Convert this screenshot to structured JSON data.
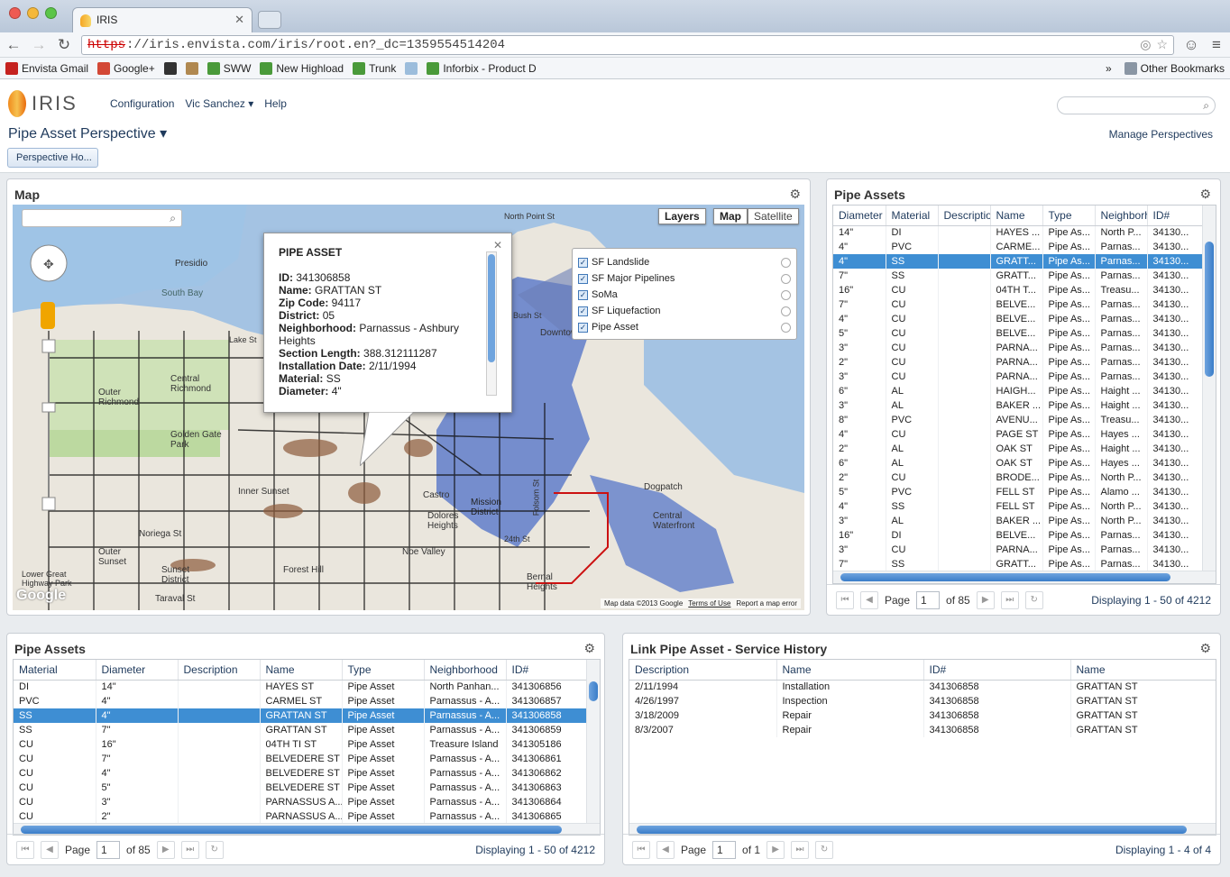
{
  "browser": {
    "tab_title": "IRIS",
    "url_scheme": "https",
    "url_rest": "://iris.envista.com/iris/root.en?_dc=1359554514204",
    "bookmarks": [
      {
        "label": "Envista Gmail",
        "color": "#c5221f"
      },
      {
        "label": "Google+",
        "color": "#d34836"
      },
      {
        "label": "",
        "color": "#333333"
      },
      {
        "label": "",
        "color": "#b08850"
      },
      {
        "label": "SWW",
        "color": "#4a9a3a"
      },
      {
        "label": "New Highload",
        "color": "#4a9a3a"
      },
      {
        "label": "Trunk",
        "color": "#4a9a3a"
      },
      {
        "label": "",
        "color": "#9cbddc"
      },
      {
        "label": "Inforbix - Product D",
        "color": "#4a9a3a"
      }
    ],
    "bookmark_more": "»",
    "other_bookmarks": "Other Bookmarks"
  },
  "header": {
    "logo_text": "IRIS",
    "nav": [
      "Configuration",
      "Vic Sanchez ▾",
      "Help"
    ],
    "search_placeholder": "",
    "perspective_title": "Pipe Asset Perspective ▾",
    "manage_perspectives": "Manage Perspectives",
    "perspective_home_button": "Perspective Ho..."
  },
  "map_panel": {
    "title": "Map",
    "layers_button": "Layers",
    "map_button": "Map",
    "satellite_button": "Satellite",
    "layers": [
      "SF Landslide",
      "SF Major Pipelines",
      "SoMa",
      "SF Liquefaction",
      "Pipe Asset"
    ],
    "attribution": "Map data ©2013 Google",
    "terms": "Terms of Use",
    "report": "Report a map error",
    "google_logo": "Google",
    "popup": {
      "heading": "PIPE ASSET",
      "fields": [
        {
          "label": "ID:",
          "value": "341306858"
        },
        {
          "label": "Name:",
          "value": "GRATTAN ST"
        },
        {
          "label": "Zip Code:",
          "value": "94117"
        },
        {
          "label": "District:",
          "value": "05"
        },
        {
          "label": "Neighborhood:",
          "value": "Parnassus - Ashbury Heights"
        },
        {
          "label": "Section Length:",
          "value": "388.312111287"
        },
        {
          "label": "Installation Date:",
          "value": "2/11/1994"
        },
        {
          "label": "Material:",
          "value": "SS"
        },
        {
          "label": "Diameter:",
          "value": "4\""
        }
      ]
    },
    "place_labels": [
      "South Bay",
      "Outer Richmond",
      "Central Richmond",
      "Golden Gate Park",
      "Inner Sunset",
      "Outer Sunset",
      "Sunset District",
      "Noriega St",
      "Taraval St",
      "Castro",
      "Dolores Heights",
      "Mission District",
      "Noe Valley",
      "Forest Hill",
      "Bernal Heights",
      "Central Waterfront",
      "Dogpatch",
      "Downtown",
      "Bush St",
      "North Point St",
      "Lake St",
      "Presidio",
      "Lower Great Highway Park",
      "24th St",
      "Folsom St"
    ]
  },
  "pipe_assets_right": {
    "title": "Pipe Assets",
    "columns": [
      "Diameter",
      "Material",
      "Description",
      "Name",
      "Type",
      "Neighborhood",
      "ID#"
    ],
    "rows": [
      [
        "14\"",
        "DI",
        "",
        "HAYES ...",
        "Pipe As...",
        "North P...",
        "34130..."
      ],
      [
        "4\"",
        "PVC",
        "",
        "CARME...",
        "Pipe As...",
        "Parnas...",
        "34130..."
      ],
      [
        "4\"",
        "SS",
        "",
        "GRATT...",
        "Pipe As...",
        "Parnas...",
        "34130..."
      ],
      [
        "7\"",
        "SS",
        "",
        "GRATT...",
        "Pipe As...",
        "Parnas...",
        "34130..."
      ],
      [
        "16\"",
        "CU",
        "",
        "04TH T...",
        "Pipe As...",
        "Treasu...",
        "34130..."
      ],
      [
        "7\"",
        "CU",
        "",
        "BELVE...",
        "Pipe As...",
        "Parnas...",
        "34130..."
      ],
      [
        "4\"",
        "CU",
        "",
        "BELVE...",
        "Pipe As...",
        "Parnas...",
        "34130..."
      ],
      [
        "5\"",
        "CU",
        "",
        "BELVE...",
        "Pipe As...",
        "Parnas...",
        "34130..."
      ],
      [
        "3\"",
        "CU",
        "",
        "PARNA...",
        "Pipe As...",
        "Parnas...",
        "34130..."
      ],
      [
        "2\"",
        "CU",
        "",
        "PARNA...",
        "Pipe As...",
        "Parnas...",
        "34130..."
      ],
      [
        "3\"",
        "CU",
        "",
        "PARNA...",
        "Pipe As...",
        "Parnas...",
        "34130..."
      ],
      [
        "6\"",
        "AL",
        "",
        "HAIGH...",
        "Pipe As...",
        "Haight ...",
        "34130..."
      ],
      [
        "3\"",
        "AL",
        "",
        "BAKER ...",
        "Pipe As...",
        "Haight ...",
        "34130..."
      ],
      [
        "8\"",
        "PVC",
        "",
        "AVENU...",
        "Pipe As...",
        "Treasu...",
        "34130..."
      ],
      [
        "4\"",
        "CU",
        "",
        "PAGE ST",
        "Pipe As...",
        "Hayes ...",
        "34130..."
      ],
      [
        "2\"",
        "AL",
        "",
        "OAK ST",
        "Pipe As...",
        "Haight ...",
        "34130..."
      ],
      [
        "6\"",
        "AL",
        "",
        "OAK ST",
        "Pipe As...",
        "Hayes ...",
        "34130..."
      ],
      [
        "2\"",
        "CU",
        "",
        "BRODE...",
        "Pipe As...",
        "North P...",
        "34130..."
      ],
      [
        "5\"",
        "PVC",
        "",
        "FELL ST",
        "Pipe As...",
        "Alamo ...",
        "34130..."
      ],
      [
        "4\"",
        "SS",
        "",
        "FELL ST",
        "Pipe As...",
        "North P...",
        "34130..."
      ],
      [
        "3\"",
        "AL",
        "",
        "BAKER ...",
        "Pipe As...",
        "North P...",
        "34130..."
      ],
      [
        "16\"",
        "DI",
        "",
        "BELVE...",
        "Pipe As...",
        "Parnas...",
        "34130..."
      ],
      [
        "3\"",
        "CU",
        "",
        "PARNA...",
        "Pipe As...",
        "Parnas...",
        "34130..."
      ],
      [
        "7\"",
        "SS",
        "",
        "GRATT...",
        "Pipe As...",
        "Parnas...",
        "34130..."
      ]
    ],
    "selected_row": 2,
    "pager": {
      "page_label": "Page",
      "page": "1",
      "of": "of 85",
      "displaying": "Displaying 1 - 50 of 4212"
    }
  },
  "pipe_assets_bottom": {
    "title": "Pipe Assets",
    "columns": [
      "Material",
      "Diameter",
      "Description",
      "Name",
      "Type",
      "Neighborhood",
      "ID#"
    ],
    "rows": [
      [
        "DI",
        "14\"",
        "",
        "HAYES ST",
        "Pipe Asset",
        "North Panhan...",
        "341306856"
      ],
      [
        "PVC",
        "4\"",
        "",
        "CARMEL ST",
        "Pipe Asset",
        "Parnassus - A...",
        "341306857"
      ],
      [
        "SS",
        "4\"",
        "",
        "GRATTAN ST",
        "Pipe Asset",
        "Parnassus - A...",
        "341306858"
      ],
      [
        "SS",
        "7\"",
        "",
        "GRATTAN ST",
        "Pipe Asset",
        "Parnassus - A...",
        "341306859"
      ],
      [
        "CU",
        "16\"",
        "",
        "04TH TI ST",
        "Pipe Asset",
        "Treasure Island",
        "341305186"
      ],
      [
        "CU",
        "7\"",
        "",
        "BELVEDERE ST",
        "Pipe Asset",
        "Parnassus - A...",
        "341306861"
      ],
      [
        "CU",
        "4\"",
        "",
        "BELVEDERE ST",
        "Pipe Asset",
        "Parnassus - A...",
        "341306862"
      ],
      [
        "CU",
        "5\"",
        "",
        "BELVEDERE ST",
        "Pipe Asset",
        "Parnassus - A...",
        "341306863"
      ],
      [
        "CU",
        "3\"",
        "",
        "PARNASSUS A...",
        "Pipe Asset",
        "Parnassus - A...",
        "341306864"
      ],
      [
        "CU",
        "2\"",
        "",
        "PARNASSUS A...",
        "Pipe Asset",
        "Parnassus - A...",
        "341306865"
      ]
    ],
    "selected_row": 2,
    "pager": {
      "page_label": "Page",
      "page": "1",
      "of": "of 85",
      "displaying": "Displaying 1 - 50 of 4212"
    }
  },
  "service_history": {
    "title": "Link Pipe Asset - Service History",
    "columns": [
      "Description",
      "Name",
      "ID#",
      "Name"
    ],
    "rows": [
      [
        "2/11/1994",
        "Installation",
        "341306858",
        "GRATTAN ST"
      ],
      [
        "4/26/1997",
        "Inspection",
        "341306858",
        "GRATTAN ST"
      ],
      [
        "3/18/2009",
        "Repair",
        "341306858",
        "GRATTAN ST"
      ],
      [
        "8/3/2007",
        "Repair",
        "341306858",
        "GRATTAN ST"
      ]
    ],
    "pager": {
      "page_label": "Page",
      "page": "1",
      "of": "of 1",
      "displaying": "Displaying 1 - 4 of 4"
    }
  }
}
